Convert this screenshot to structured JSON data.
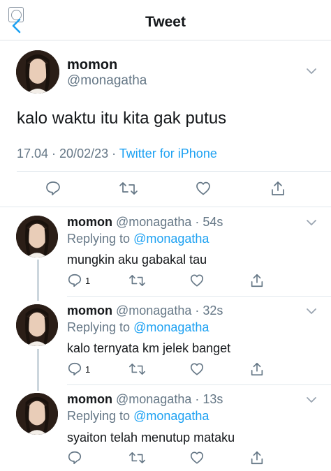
{
  "header": {
    "title": "Tweet"
  },
  "main_tweet": {
    "display_name": "momon",
    "handle": "@monagatha",
    "text": "kalo waktu itu kita gak putus",
    "time": "17.04 · 20/02/23 · ",
    "source": "Twitter for iPhone"
  },
  "replies": [
    {
      "display_name": "momon",
      "meta": " @monagatha · 54s",
      "replying_prefix": "Replying to ",
      "replying_to": "@monagatha",
      "text": "mungkin aku gabakal tau",
      "reply_count": "1"
    },
    {
      "display_name": "momon",
      "meta": " @monagatha · 32s",
      "replying_prefix": "Replying to ",
      "replying_to": "@monagatha",
      "text": "kalo ternyata km jelek banget",
      "reply_count": "1"
    },
    {
      "display_name": "momon",
      "meta": " @monagatha · 13s",
      "replying_prefix": "Replying to ",
      "replying_to": "@monagatha",
      "text": "syaiton telah menutup mataku",
      "reply_count": ""
    }
  ],
  "colors": {
    "accent": "#1da1f2",
    "secondary_text": "#657786",
    "divider": "#e1e8ed"
  },
  "icons": [
    "back-chevron-icon",
    "reply-icon",
    "retweet-icon",
    "like-icon",
    "share-icon",
    "chevron-down-icon"
  ]
}
